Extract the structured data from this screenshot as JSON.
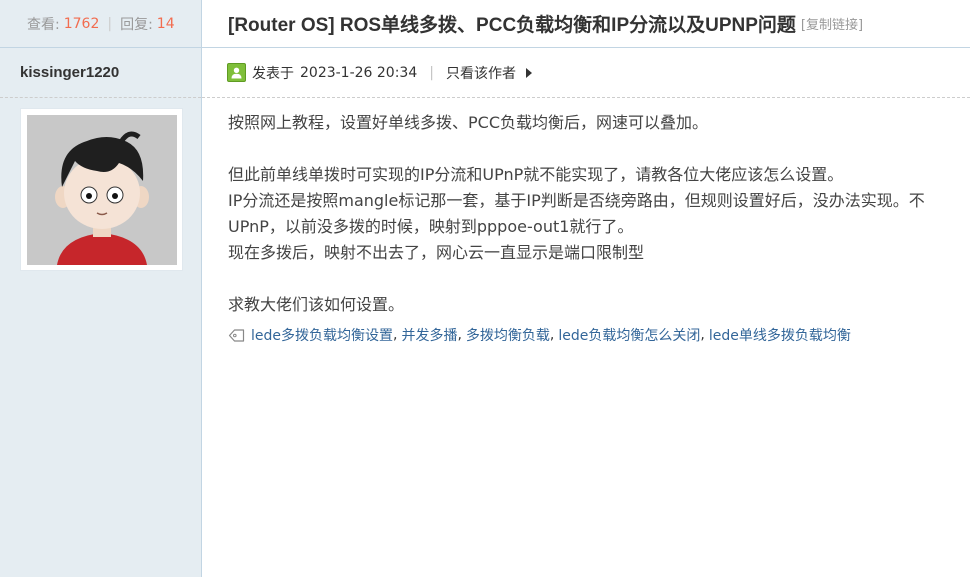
{
  "stats": {
    "views_label": "查看:",
    "views": "1762",
    "replies_label": "回复:",
    "replies": "14"
  },
  "author": {
    "name": "kissinger1220"
  },
  "title": {
    "text": "[Router OS] ROS单线多拨、PCC负载均衡和IP分流以及UPNP问题",
    "copy_link": "[复制链接]"
  },
  "meta": {
    "posted_label": "发表于",
    "posted_at": "2023-1-26 20:34",
    "separator": "|",
    "only_author": "只看该作者"
  },
  "post": {
    "lines": [
      "按照网上教程，设置好单线多拨、PCC负载均衡后，网速可以叠加。",
      "",
      "但此前单线单拨时可实现的IP分流和UPnP就不能实现了，请教各位大佬应该怎么设置。",
      "IP分流还是按照mangle标记那一套，基于IP判断是否绕旁路由，但规则设置好后，没办法实现。不",
      "UPnP，以前没多拨的时候，映射到pppoe-out1就行了。",
      "现在多拨后，映射不出去了，网心云一直显示是端口限制型",
      "",
      "求教大佬们该如何设置。"
    ]
  },
  "tags": [
    "lede多拨负载均衡设置",
    "并发多播",
    "多拨均衡负载",
    "lede负载均衡怎么关闭",
    "lede单线多拨负载均衡"
  ],
  "icons": {
    "online": "online-status-icon",
    "arrow": "arrow-right-icon",
    "tag": "tag-icon"
  },
  "colors": {
    "sidebar_bg": "#e5edf2",
    "border": "#c2d5e3",
    "stat_number": "#f26c4f",
    "tag_link": "#336699"
  }
}
